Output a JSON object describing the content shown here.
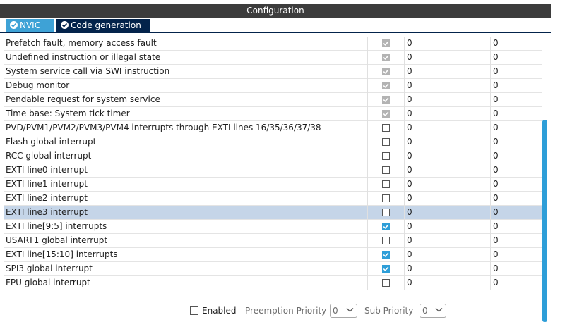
{
  "window": {
    "title": "Configuration"
  },
  "tabs": [
    {
      "label": "NVIC"
    },
    {
      "label": "Code generation"
    }
  ],
  "rows": [
    {
      "name": "Prefetch fault, memory access fault",
      "enabled": "disabled-checked",
      "preemption": "0",
      "sub": "0"
    },
    {
      "name": "Undefined instruction or illegal state",
      "enabled": "disabled-checked",
      "preemption": "0",
      "sub": "0"
    },
    {
      "name": "System service call via SWI instruction",
      "enabled": "disabled-checked",
      "preemption": "0",
      "sub": "0"
    },
    {
      "name": "Debug monitor",
      "enabled": "disabled-checked",
      "preemption": "0",
      "sub": "0"
    },
    {
      "name": "Pendable request for system service",
      "enabled": "disabled-checked",
      "preemption": "0",
      "sub": "0"
    },
    {
      "name": "Time base: System tick timer",
      "enabled": "disabled-checked",
      "preemption": "0",
      "sub": "0"
    },
    {
      "name": "PVD/PVM1/PVM2/PVM3/PVM4 interrupts through EXTI lines 16/35/36/37/38",
      "enabled": "unchecked",
      "preemption": "0",
      "sub": "0"
    },
    {
      "name": "Flash global interrupt",
      "enabled": "unchecked",
      "preemption": "0",
      "sub": "0"
    },
    {
      "name": "RCC global interrupt",
      "enabled": "unchecked",
      "preemption": "0",
      "sub": "0"
    },
    {
      "name": "EXTI line0 interrupt",
      "enabled": "unchecked",
      "preemption": "0",
      "sub": "0"
    },
    {
      "name": "EXTI line1 interrupt",
      "enabled": "unchecked",
      "preemption": "0",
      "sub": "0"
    },
    {
      "name": "EXTI line2 interrupt",
      "enabled": "unchecked",
      "preemption": "0",
      "sub": "0"
    },
    {
      "name": "EXTI line3 interrupt",
      "enabled": "unchecked",
      "preemption": "0",
      "sub": "0",
      "selected": true
    },
    {
      "name": "EXTI line[9:5] interrupts",
      "enabled": "checked",
      "preemption": "0",
      "sub": "0"
    },
    {
      "name": "USART1 global interrupt",
      "enabled": "unchecked",
      "preemption": "0",
      "sub": "0"
    },
    {
      "name": "EXTI line[15:10] interrupts",
      "enabled": "checked",
      "preemption": "0",
      "sub": "0"
    },
    {
      "name": "SPI3 global interrupt",
      "enabled": "checked",
      "preemption": "0",
      "sub": "0"
    },
    {
      "name": "FPU global interrupt",
      "enabled": "unchecked",
      "preemption": "0",
      "sub": "0"
    }
  ],
  "footer": {
    "enabled_label": "Enabled",
    "preemption_label": "Preemption Priority",
    "preemption_value": "0",
    "sub_label": "Sub Priority",
    "sub_value": "0"
  },
  "colors": {
    "title_bar": "#3c3c3c",
    "tab_active": "#3ea2d6",
    "tab_dark": "#03234b",
    "checkbox_checked": "#2e9ed8",
    "checkbox_disabled": "#b3b3b3",
    "row_selected": "#c5d5e8",
    "scrollbar": "#2e9ed8"
  }
}
